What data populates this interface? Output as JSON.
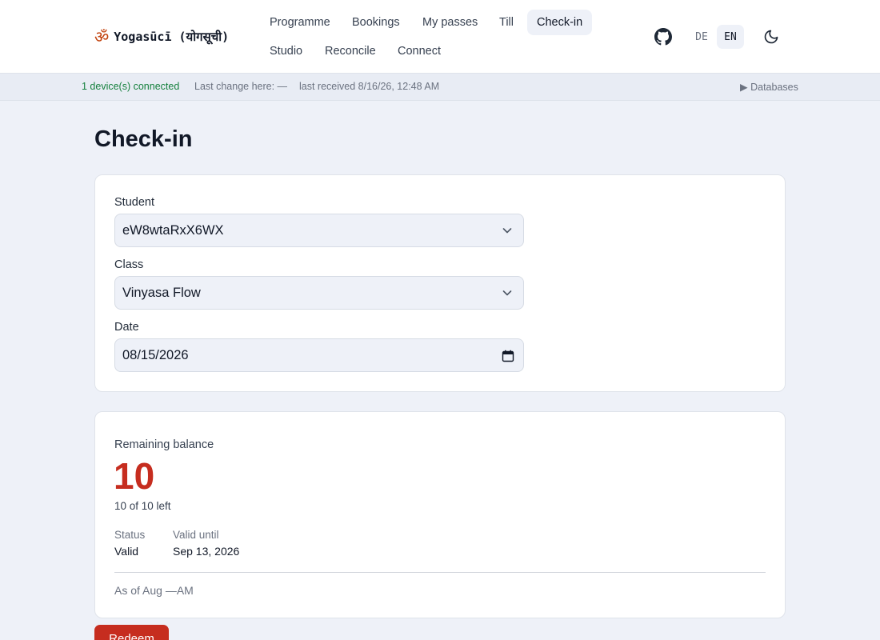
{
  "brand": {
    "icon": "om-icon",
    "name": "Yogasūcī (योगसूची)"
  },
  "nav": {
    "items": [
      {
        "label": "Programme"
      },
      {
        "label": "Bookings"
      },
      {
        "label": "My passes"
      },
      {
        "label": "Till"
      },
      {
        "label": "Check-in"
      },
      {
        "label": "Studio"
      },
      {
        "label": "Reconcile"
      },
      {
        "label": "Connect"
      }
    ],
    "active": "Check-in"
  },
  "header": {
    "github_icon": "github-icon",
    "languages": [
      "DE",
      "EN"
    ],
    "active_language": "EN",
    "theme_icon": "moon-icon"
  },
  "status": {
    "connected": "1 device(s) connected",
    "last_change": "Last change here: —",
    "last_received": "last received 8/16/26, 12:48 AM",
    "databases": "▶ Databases"
  },
  "page": {
    "title": "Check-in"
  },
  "form": {
    "student_label": "Student",
    "student_value": "eW8wtaRxX6WX",
    "class_label": "Class",
    "class_value": "Vinyasa Flow",
    "date_label": "Date",
    "date_value": "08/15/2026"
  },
  "balance": {
    "label": "Remaining balance",
    "value": "10",
    "sub": "10 of 10 left",
    "status_label": "Status",
    "status_value": "Valid",
    "valid_until_label": "Valid until",
    "valid_until_value": "Sep 13, 2026",
    "as_of": "As of Aug —AM"
  },
  "actions": {
    "redeem_label": "Redeem"
  },
  "colors": {
    "accent": "#c62d1f",
    "connected": "#15803d",
    "background": "#eef1f8"
  }
}
